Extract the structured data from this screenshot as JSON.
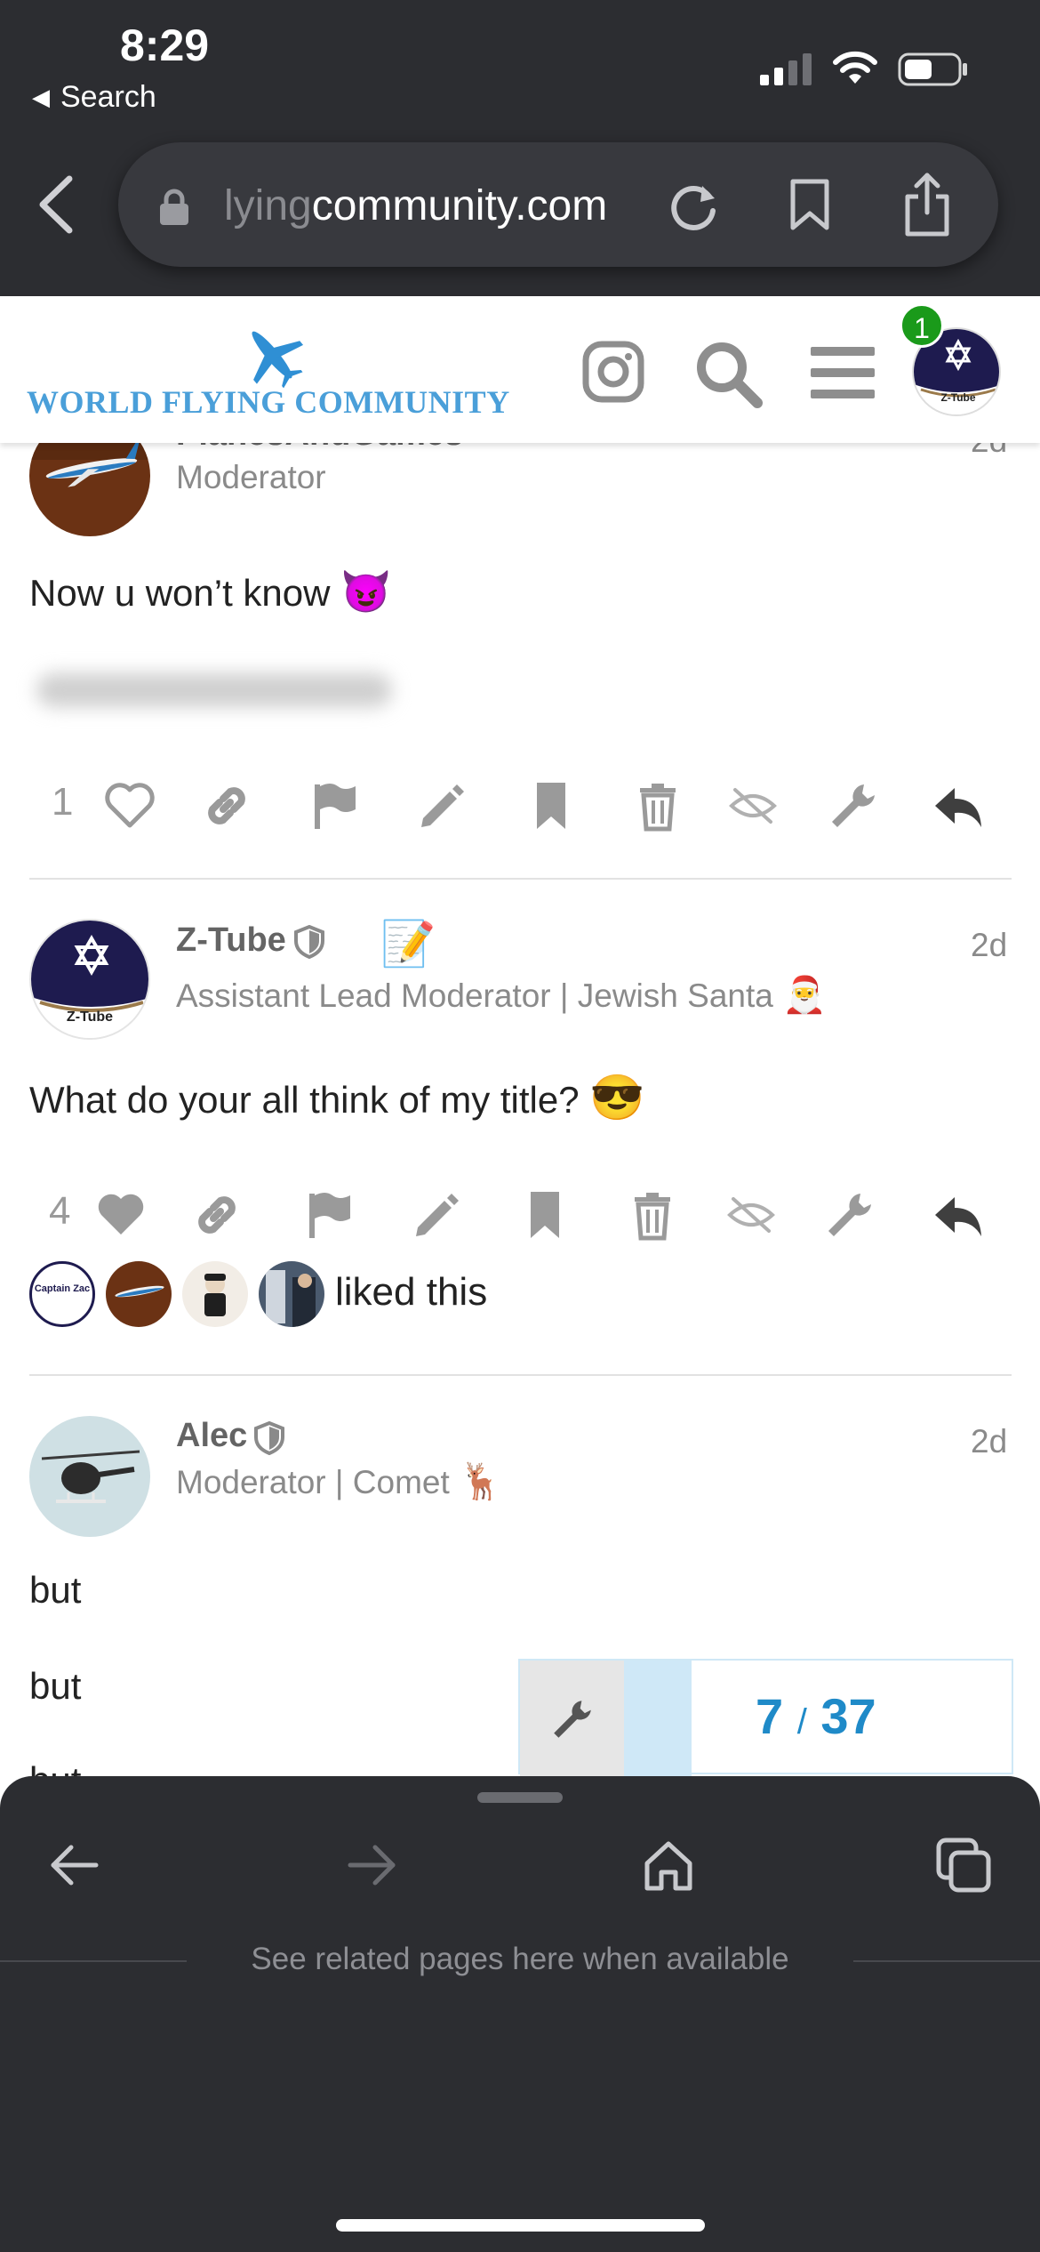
{
  "status_bar": {
    "time": "8:29",
    "back_app": "Search"
  },
  "browser": {
    "url_faded": "lying",
    "url_main": "community.com",
    "related_text": "See related pages here when available"
  },
  "site": {
    "logo_text": "WORLD FLYING COMMUNITY",
    "notification_count": "1",
    "header_avatar_label": "Z-Tube"
  },
  "posts": [
    {
      "username": "PlanesAndGames",
      "user_title": "Moderator",
      "date": "2d",
      "text": "Now u won’t know",
      "emoji": "😈",
      "like_count": "1"
    },
    {
      "username": "Z-Tube",
      "user_title": "Assistant Lead Moderator | Jewish Santa",
      "user_title_emoji": "🎅",
      "status_emoji": "📝",
      "date": "2d",
      "text": "What do your all think of my title?",
      "emoji": "😎",
      "like_count": "4",
      "liked_text": "liked this",
      "avatar_label": "Z-Tube",
      "liker_1_label": "Captain Zac"
    },
    {
      "username": "Alec",
      "user_title": "Moderator | Comet",
      "user_title_emoji": "🦌",
      "date": "2d",
      "lines": [
        "but",
        "but",
        "but"
      ]
    }
  ],
  "timeline": {
    "current": "7",
    "separator": "/",
    "total": "37",
    "progress_fraction": 0.19
  },
  "colors": {
    "browser_chrome": "#2c2d31",
    "logo_blue": "#4a9fd9",
    "timeline_blue": "#1f8ac8",
    "badge_green": "#1a9a1a"
  }
}
